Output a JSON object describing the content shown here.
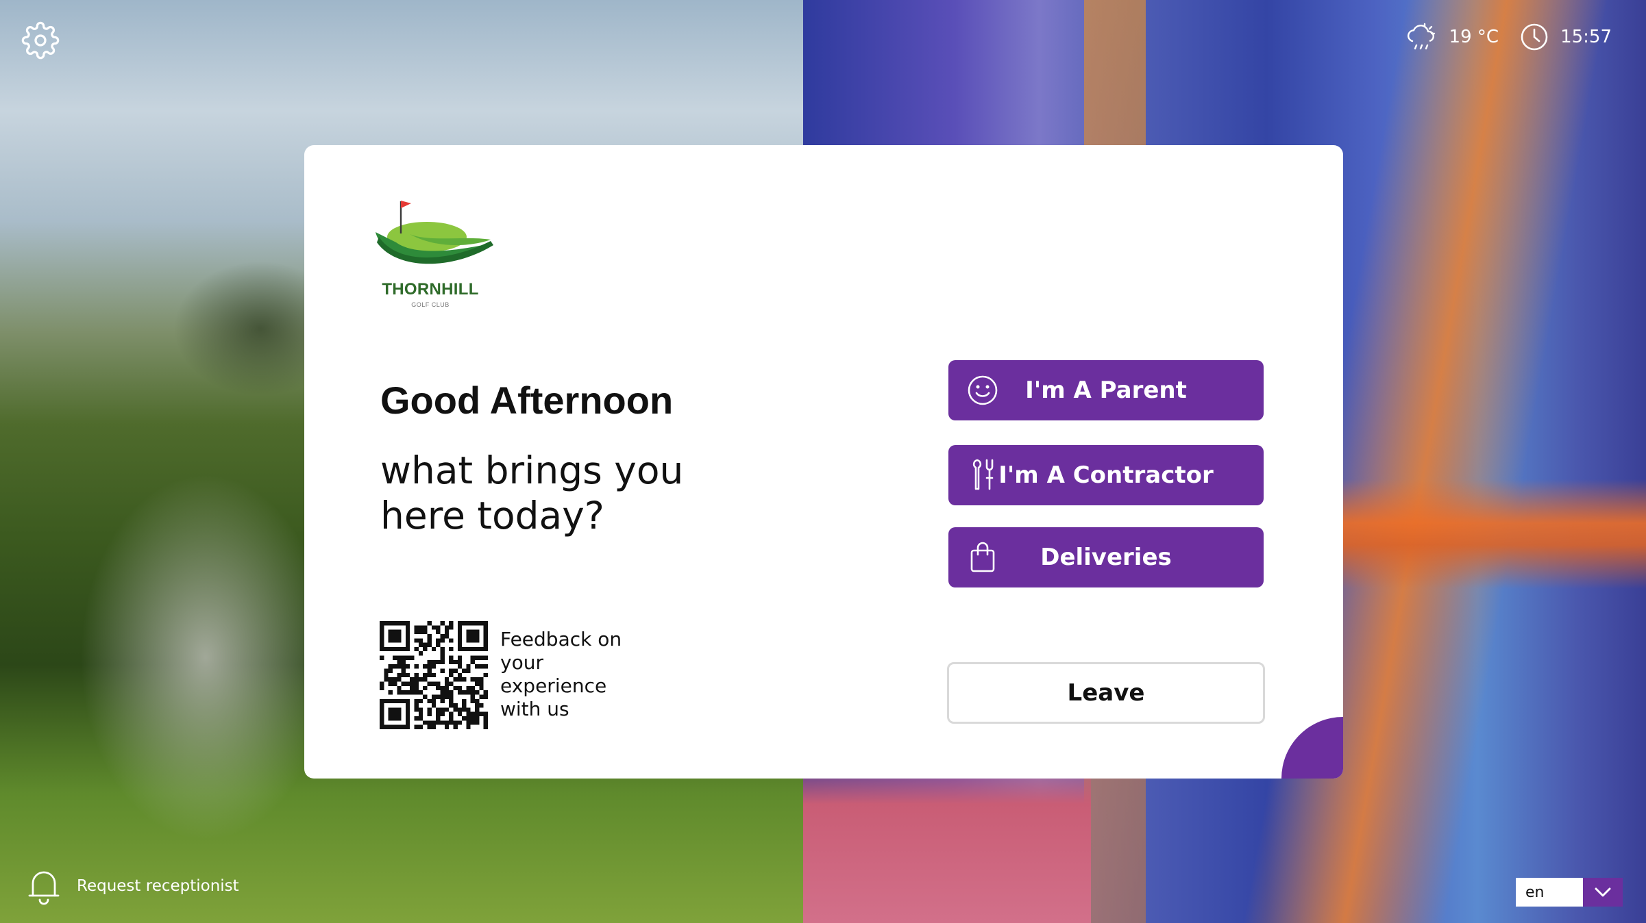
{
  "theme": {
    "accent": "#6b2f9e",
    "logo_green": "#2f6b2a"
  },
  "header": {
    "settings_icon": "gear-icon",
    "weather_icon": "cloudy-rain-sun-icon",
    "temperature": "19 °C",
    "clock_icon": "clock-icon",
    "time": "15:57"
  },
  "card": {
    "logo": {
      "brand": "THORNHILL",
      "subtitle": "GOLF CLUB"
    },
    "greeting": "Good Afternoon",
    "question": "what brings you here today?",
    "qr": {
      "caption": "Feedback on your experience with us"
    },
    "actions": [
      {
        "label": "I'm A Parent",
        "icon": "smiley-icon"
      },
      {
        "label": "I'm A Contractor",
        "icon": "tools-icon"
      },
      {
        "label": "Deliveries",
        "icon": "shopping-bag-icon"
      }
    ],
    "leave_label": "Leave"
  },
  "footer": {
    "reception_label": "Request receptionist",
    "reception_icon": "bell-icon",
    "language": {
      "selected": "en",
      "icon": "chevron-down-icon"
    }
  }
}
